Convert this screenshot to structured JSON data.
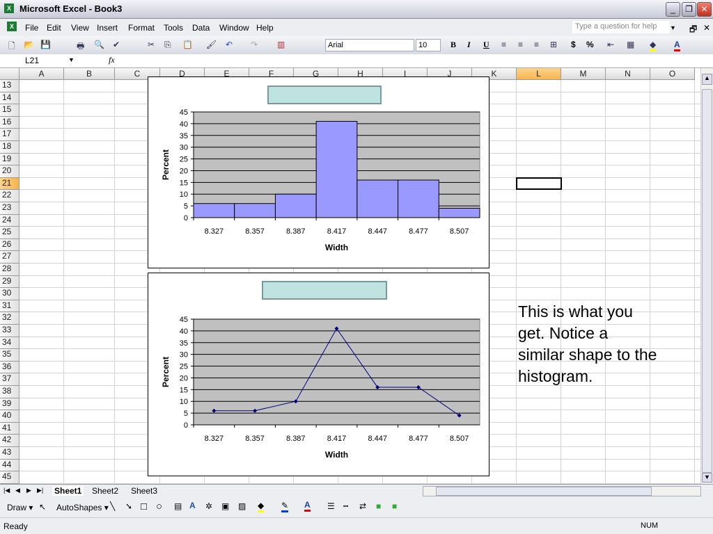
{
  "window": {
    "title": "Microsoft Excel - Book3",
    "minimize": "_",
    "restore": "❐",
    "close": "✕"
  },
  "menu": {
    "items": [
      "File",
      "Edit",
      "View",
      "Insert",
      "Format",
      "Tools",
      "Data",
      "Window",
      "Help"
    ],
    "help_placeholder": "Type a question for help"
  },
  "toolbar": {
    "font": "Arial",
    "size": "10",
    "bold": "B",
    "italic": "I",
    "underline": "U",
    "currency": "$",
    "percent": "%"
  },
  "formula": {
    "name_box": "L21",
    "fx": "fx",
    "value": ""
  },
  "columns": [
    "A",
    "B",
    "C",
    "D",
    "E",
    "F",
    "G",
    "H",
    "I",
    "J",
    "K",
    "L",
    "M",
    "N",
    "O"
  ],
  "selected_column": "L",
  "rows": [
    "13",
    "14",
    "15",
    "16",
    "17",
    "18",
    "19",
    "20",
    "21",
    "22",
    "23",
    "24",
    "25",
    "26",
    "27",
    "28",
    "29",
    "30",
    "31",
    "32",
    "33",
    "34",
    "35",
    "36",
    "37",
    "38",
    "39",
    "40",
    "41",
    "42",
    "43",
    "44",
    "45"
  ],
  "selected_row": "21",
  "note": "This is what you get.  Notice a similar shape to the histogram.",
  "sheets": [
    "Sheet1",
    "Sheet2",
    "Sheet3"
  ],
  "active_sheet": "Sheet1",
  "drawbar": {
    "draw": "Draw ▾",
    "autoshapes": "AutoShapes ▾"
  },
  "status": {
    "left": "Ready",
    "right": "NUM"
  },
  "chart_data": [
    {
      "type": "bar",
      "title": "",
      "categories": [
        "8.327",
        "8.357",
        "8.387",
        "8.417",
        "8.447",
        "8.477",
        "8.507"
      ],
      "values": [
        6,
        6,
        10,
        41,
        16,
        16,
        4
      ],
      "xlabel": "Width",
      "ylabel": "Percent",
      "ylim": [
        0,
        45
      ],
      "yticks": [
        0,
        5,
        10,
        15,
        20,
        25,
        30,
        35,
        40,
        45
      ],
      "bar_color": "#9999ff",
      "plot_bg": "#c0c0c0",
      "grid": true
    },
    {
      "type": "line",
      "title": "",
      "categories": [
        "8.327",
        "8.357",
        "8.387",
        "8.417",
        "8.447",
        "8.477",
        "8.507"
      ],
      "values": [
        6,
        6,
        10,
        41,
        16,
        16,
        4
      ],
      "xlabel": "Width",
      "ylabel": "Percent",
      "ylim": [
        0,
        45
      ],
      "yticks": [
        0,
        5,
        10,
        15,
        20,
        25,
        30,
        35,
        40,
        45
      ],
      "line_color": "#000080",
      "plot_bg": "#c0c0c0",
      "grid": true
    }
  ]
}
